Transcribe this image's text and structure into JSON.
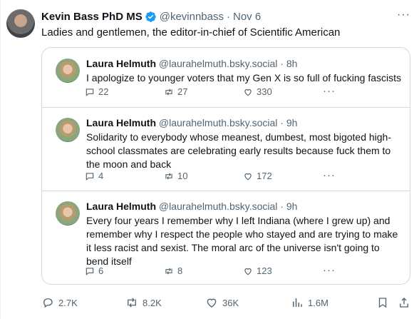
{
  "tweet": {
    "author_name": "Kevin Bass PhD MS",
    "handle": "@kevinnbass",
    "separator": "·",
    "date": "Nov 6",
    "more": "···",
    "text": "Ladies and gentlemen, the editor-in-chief of Scientific American",
    "verified_icon": "verified-badge-icon",
    "accent_color": "#1d9bf0"
  },
  "quote": {
    "posts": [
      {
        "name": "Laura Helmuth",
        "handle": "@laurahelmuth.bsky.social",
        "sep": "·",
        "time": "8h",
        "text": "I apologize to younger voters that my Gen X is so full of fucking fascists",
        "replies": "22",
        "reposts": "27",
        "likes": "330",
        "more": "···"
      },
      {
        "name": "Laura Helmuth",
        "handle": "@laurahelmuth.bsky.social",
        "sep": "·",
        "time": "9h",
        "text": "Solidarity to everybody whose meanest, dumbest, most bigoted high-school classmates are celebrating early results because fuck them to the moon and back",
        "replies": "4",
        "reposts": "10",
        "likes": "172",
        "more": "···"
      },
      {
        "name": "Laura Helmuth",
        "handle": "@laurahelmuth.bsky.social",
        "sep": "·",
        "time": "9h",
        "text": "Every four years I remember why I left Indiana (where I grew up) and remember why I respect the people who stayed and are trying to make it less racist and sexist. The moral arc of the universe isn't going to bend itself",
        "replies": "6",
        "reposts": "8",
        "likes": "123",
        "more": "···"
      }
    ]
  },
  "actions": {
    "replies": "2.7K",
    "reposts": "8.2K",
    "likes": "36K",
    "views": "1.6M"
  }
}
